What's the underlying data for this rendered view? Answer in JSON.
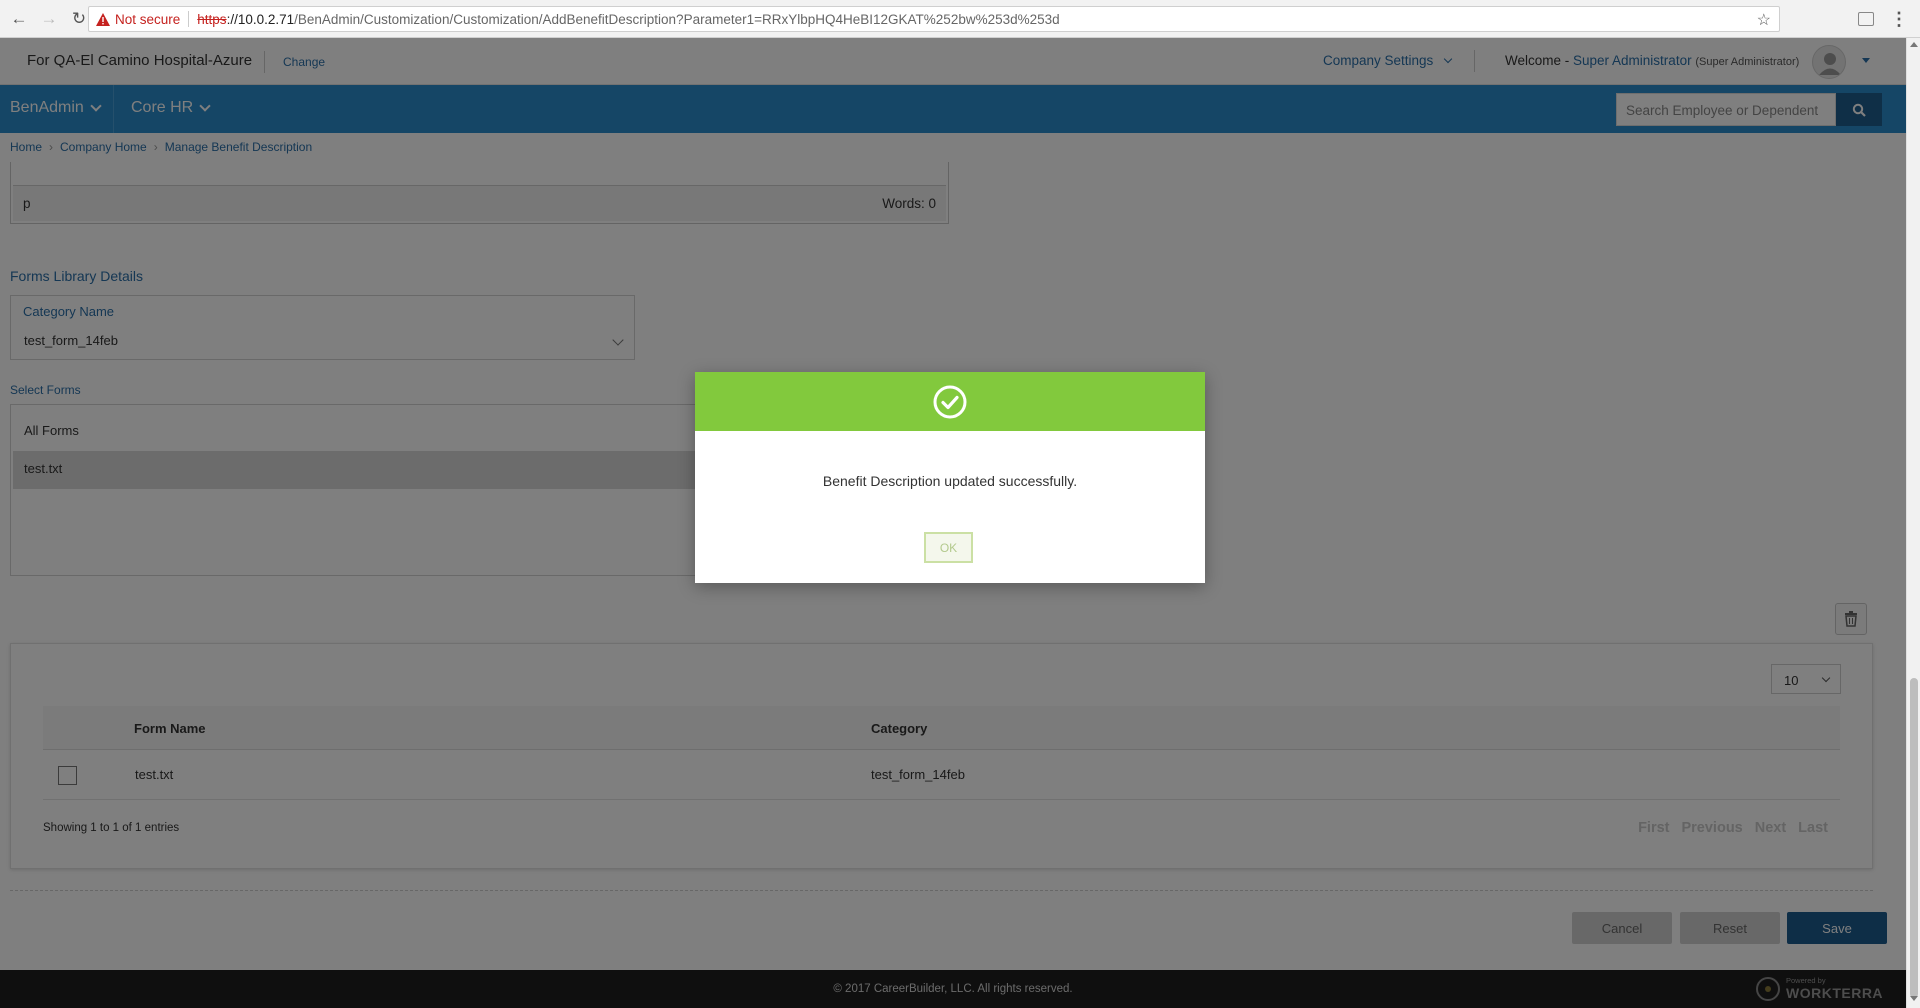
{
  "browser": {
    "not_secure": "Not secure",
    "url_scheme": "https",
    "url_host": "://10.0.2.71",
    "url_path": "/BenAdmin/Customization/Customization/AddBenefitDescription?Parameter1=RRxYlbpHQ4HeBI12GKAT%252bw%253d%253d"
  },
  "header": {
    "company": "For QA-El Camino Hospital-Azure",
    "change": "Change",
    "company_settings": "Company Settings",
    "welcome": "Welcome - ",
    "user_name": "Super Administrator",
    "user_role": "(Super Administrator)"
  },
  "nav": {
    "items": [
      {
        "label": "BenAdmin"
      },
      {
        "label": "Core HR"
      }
    ],
    "search_placeholder": "Search Employee or Dependent"
  },
  "breadcrumb": [
    "Home",
    "Company Home",
    "Manage Benefit Description"
  ],
  "editor": {
    "path": "p",
    "words": "Words: 0"
  },
  "forms_library": {
    "title": "Forms Library Details",
    "category_label": "Category Name",
    "category_value": "test_form_14feb",
    "select_forms_label": "Select Forms",
    "list": [
      "All Forms",
      "test.txt"
    ],
    "selected_index": 1
  },
  "table": {
    "page_size": "10",
    "columns": [
      "Form Name",
      "Category"
    ],
    "rows": [
      {
        "form_name": "test.txt",
        "category": "test_form_14feb",
        "checked": false
      }
    ],
    "showing": "Showing 1 to 1 of 1 entries",
    "pager": [
      "First",
      "Previous",
      "Next",
      "Last"
    ]
  },
  "actions": {
    "cancel": "Cancel",
    "reset": "Reset",
    "save": "Save"
  },
  "footer": {
    "copyright": "© 2017 CareerBuilder, LLC. All rights reserved.",
    "powered_by": "Powered by",
    "brand": "WORKTERRA"
  },
  "modal": {
    "message": "Benefit Description updated successfully.",
    "ok": "OK"
  },
  "colors": {
    "nav_blue": "#2b8ccc",
    "success_green": "#82c93d",
    "save_blue": "#1d5c8f",
    "link_blue": "#2a6fa8"
  }
}
